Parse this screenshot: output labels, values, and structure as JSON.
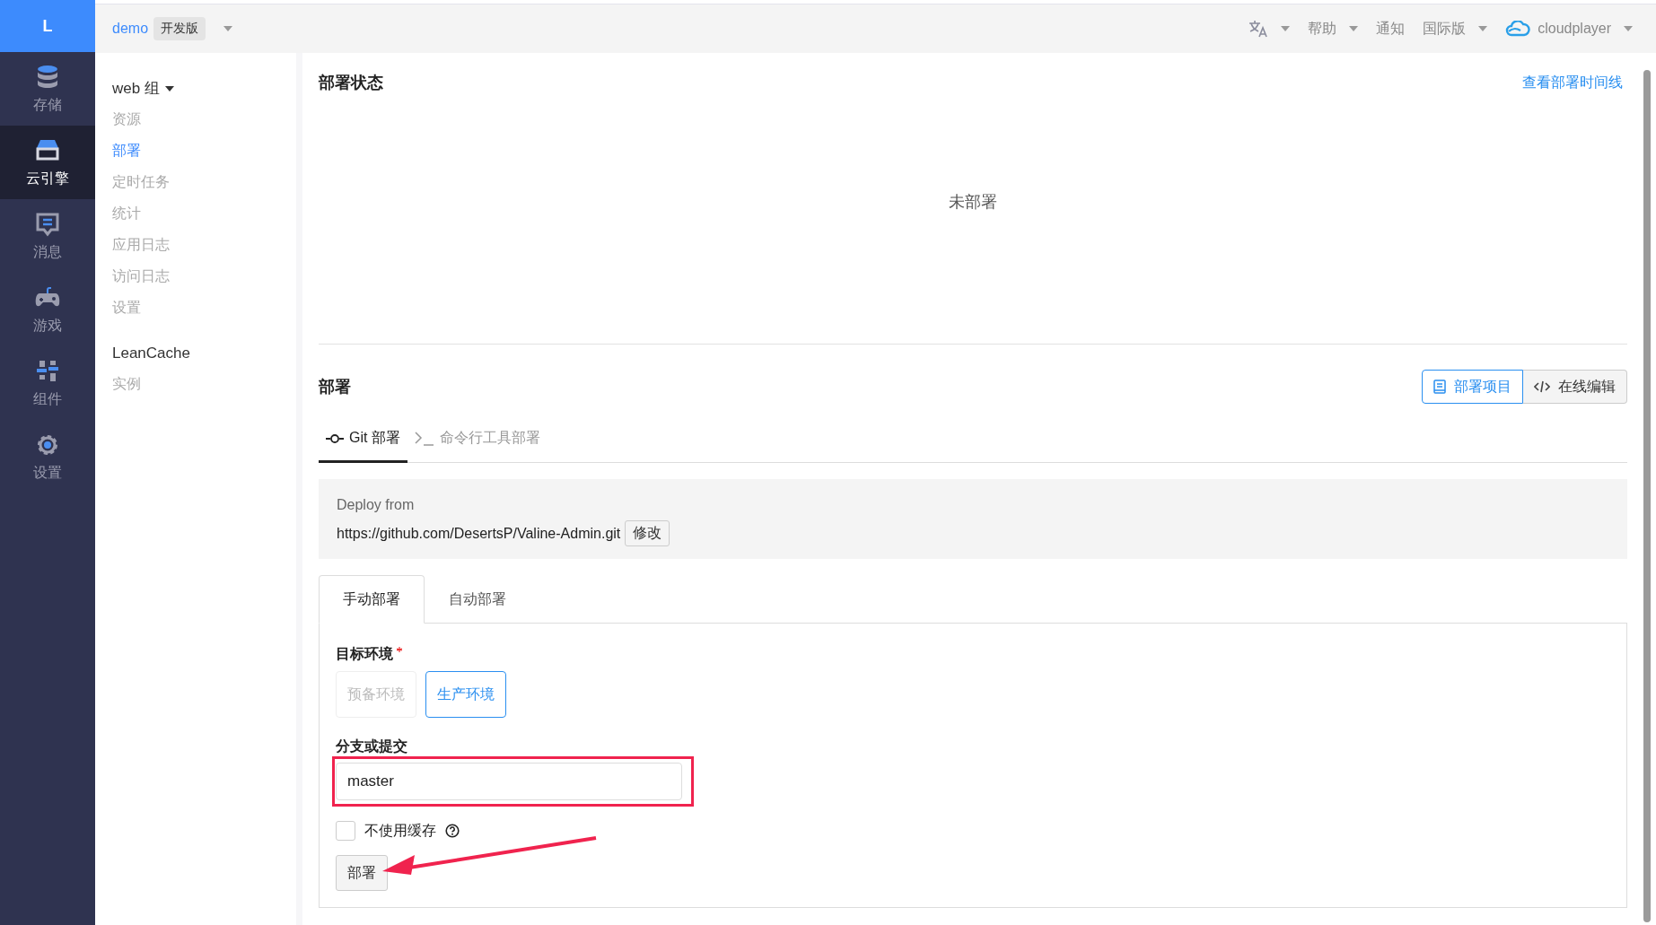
{
  "app": {
    "logo": "L",
    "name": "demo",
    "edition": "开发版"
  },
  "rail": [
    {
      "label": "存储",
      "kind": "database",
      "selected": false
    },
    {
      "label": "云引擎",
      "kind": "drawer",
      "selected": true
    },
    {
      "label": "消息",
      "kind": "message",
      "selected": false
    },
    {
      "label": "游戏",
      "kind": "gamepad",
      "selected": false
    },
    {
      "label": "组件",
      "kind": "sliders",
      "selected": false
    },
    {
      "label": "设置",
      "kind": "gear",
      "selected": false
    }
  ],
  "topbar": {
    "menus": [
      {
        "kind": "translate",
        "dropdown": true
      },
      {
        "kind": "text",
        "label": "帮助",
        "dropdown": true
      },
      {
        "kind": "text",
        "label": "通知",
        "dropdown": false
      },
      {
        "kind": "text",
        "label": "国际版",
        "dropdown": true
      },
      {
        "kind": "user",
        "label": "cloudplayer",
        "dropdown": true
      }
    ]
  },
  "subnav": [
    {
      "title": "web 组",
      "dropdown": true,
      "items": [
        {
          "label": "资源",
          "selected": false
        },
        {
          "label": "部署",
          "selected": true
        },
        {
          "label": "定时任务",
          "selected": false
        },
        {
          "label": "统计",
          "selected": false
        },
        {
          "label": "应用日志",
          "selected": false
        },
        {
          "label": "访问日志",
          "selected": false
        },
        {
          "label": "设置",
          "selected": false
        }
      ]
    },
    {
      "title": "LeanCache",
      "dropdown": false,
      "items": [
        {
          "label": "实例",
          "selected": false
        }
      ]
    }
  ],
  "status": {
    "title": "部署状态",
    "link": "查看部署时间线",
    "empty": "未部署"
  },
  "deploy": {
    "title": "部署",
    "actions": [
      {
        "label": "部署项目",
        "kind": "book",
        "selected": true
      },
      {
        "label": "在线编辑",
        "kind": "code",
        "selected": false
      }
    ],
    "tabs": [
      {
        "label": "Git 部署",
        "kind": "git",
        "selected": true
      },
      {
        "label": "命令行工具部署",
        "kind": "terminal",
        "selected": false
      }
    ],
    "source": {
      "label": "Deploy from",
      "url": "https://github.com/DesertsP/Valine-Admin.git",
      "edit": "修改"
    },
    "mode_tabs": [
      {
        "label": "手动部署",
        "selected": true
      },
      {
        "label": "自动部署",
        "selected": false
      }
    ],
    "env": {
      "label": "目标环境",
      "required": true,
      "options": [
        {
          "label": "预备环境",
          "selected": false,
          "disabled": true
        },
        {
          "label": "生产环境",
          "selected": true,
          "disabled": false
        }
      ]
    },
    "branch": {
      "label": "分支或提交",
      "value": "master"
    },
    "no_cache": {
      "label": "不使用缓存",
      "checked": false,
      "help": true
    },
    "submit": "部署"
  }
}
